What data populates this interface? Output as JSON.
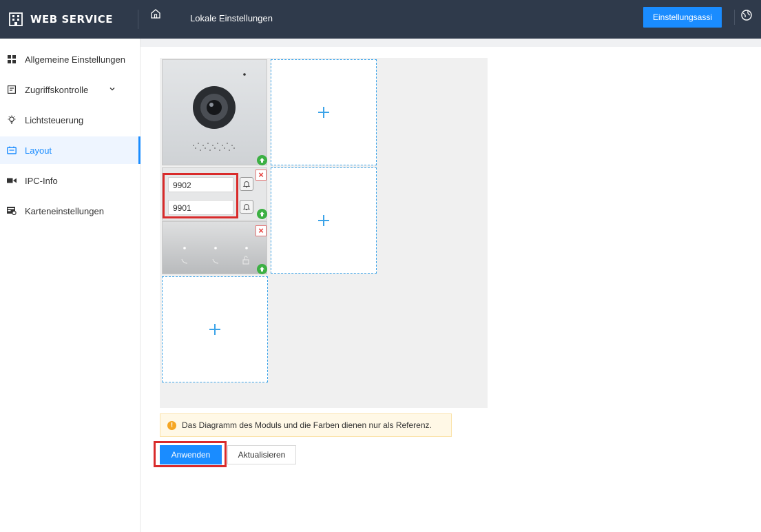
{
  "header": {
    "logo_text": "WEB SERVICE",
    "page_title": "Lokale Einstellungen",
    "wizard_button": "Einstellungsassi",
    "icons": [
      "building-logo-icon",
      "home-icon",
      "globe-icon"
    ]
  },
  "sidebar": {
    "items": [
      {
        "label": "Allgemeine Einstellungen",
        "icon": "grid-icon",
        "active": false
      },
      {
        "label": "Zugriffskontrolle",
        "icon": "door-icon",
        "active": false,
        "expandable": true
      },
      {
        "label": "Lichtsteuerung",
        "icon": "lightbulb-icon",
        "active": false
      },
      {
        "label": "Layout",
        "icon": "layout-icon",
        "active": true
      },
      {
        "label": "IPC-Info",
        "icon": "camera-icon",
        "active": false
      },
      {
        "label": "Karteneinstellungen",
        "icon": "card-settings-icon",
        "active": false
      }
    ]
  },
  "layout_editor": {
    "modules": {
      "button_module": {
        "numbers": [
          "9902",
          "9901"
        ]
      }
    }
  },
  "notice": {
    "text": "Das Diagramm des Moduls und die Farben dienen nur als Referenz."
  },
  "actions": {
    "apply_label": "Anwenden",
    "refresh_label": "Aktualisieren"
  },
  "colors": {
    "header_bg": "#2f3a4b",
    "accent": "#1a8cff",
    "highlight": "#d92b2b",
    "slot_border": "#3ba3e8"
  }
}
